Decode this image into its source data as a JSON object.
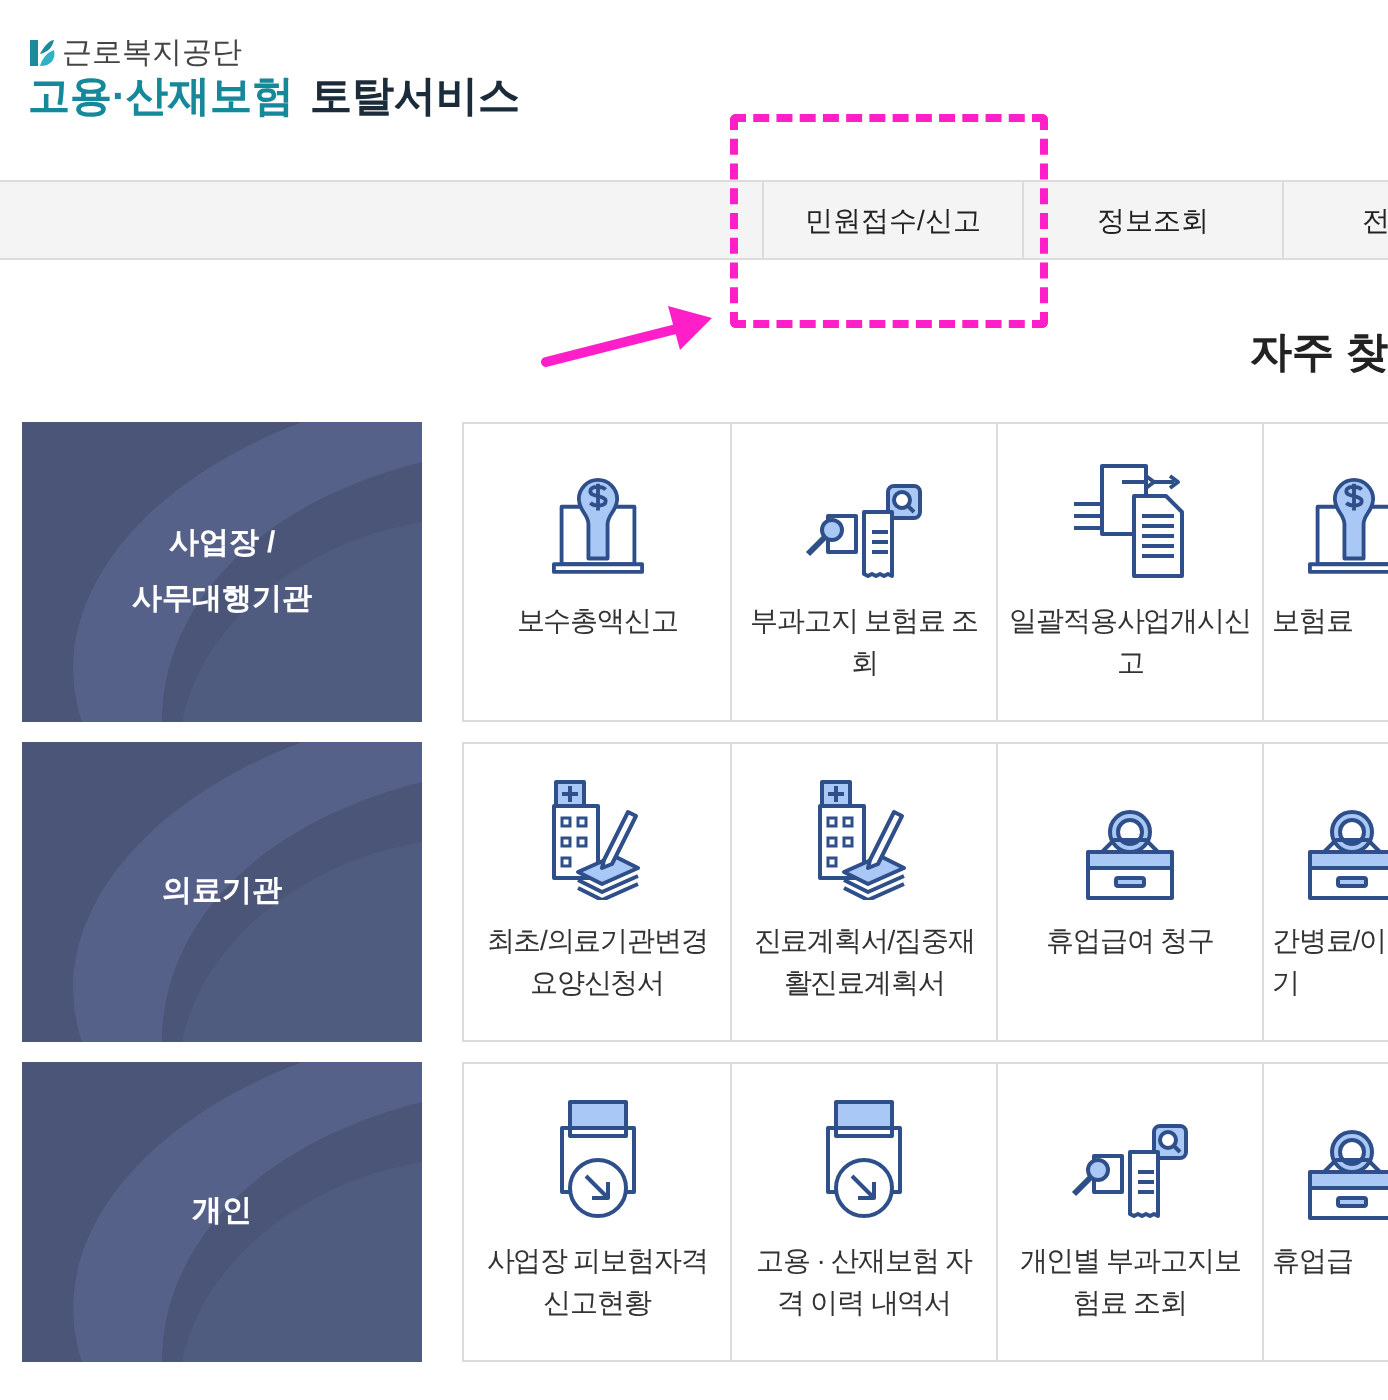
{
  "logo": {
    "org": "근로복지공단",
    "service_highlight": "고용·산재보험",
    "service_rest": "토탈서비스"
  },
  "nav": [
    {
      "label": "민원접수/신고"
    },
    {
      "label": "정보조회"
    },
    {
      "label": "전"
    }
  ],
  "section_title": "자주 찾",
  "annotation": {
    "kind": "highlight"
  },
  "groups": [
    {
      "category": "사업장 /\n사무대행기관",
      "services": [
        {
          "label": "보수총액신고"
        },
        {
          "label": "부과고지 보험료 조\n회"
        },
        {
          "label": "일괄적용사업개시신\n고"
        },
        {
          "label": "보험료",
          "kind": "cut"
        }
      ]
    },
    {
      "category": "의료기관",
      "services": [
        {
          "label": "최초/의료기관변경\n요양신청서"
        },
        {
          "label": "진료계획서/집중재\n활진료계획서"
        },
        {
          "label": "휴업급여 청구"
        },
        {
          "label": "간병료/이\n기",
          "kind": "cut"
        }
      ]
    },
    {
      "category": "개인",
      "services": [
        {
          "label": "사업장 피보험자격\n신고현황"
        },
        {
          "label": "고용 · 산재보험 자\n격 이력 내역서"
        },
        {
          "label": "개인별 부과고지보\n험료 조회"
        },
        {
          "label": "휴업급",
          "kind": "cut"
        }
      ]
    }
  ]
}
